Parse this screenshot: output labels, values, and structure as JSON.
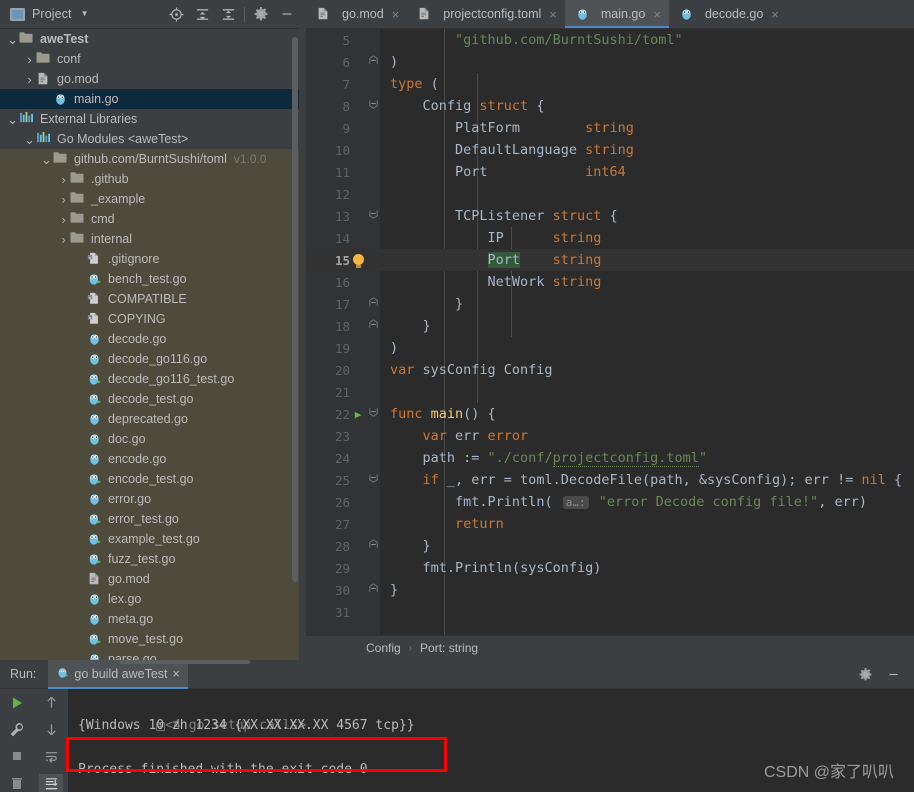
{
  "project_panel": {
    "title": "Project",
    "title_icon": "project-panel-icon",
    "chevron_icon": "chevron-down-icon",
    "tools": [
      {
        "name": "locate-file-icon",
        "label": "Select Opened File"
      },
      {
        "name": "expand-all-icon",
        "label": "Expand All"
      },
      {
        "name": "collapse-all-icon",
        "label": "Collapse All"
      },
      {
        "name": "gear-icon",
        "label": "Settings"
      },
      {
        "name": "minimize-icon",
        "label": "Hide"
      }
    ],
    "tree": [
      {
        "label": "aweTest",
        "indent": 0,
        "arrow": "down",
        "icon": "folder-module-icon",
        "bold": true,
        "selected": false,
        "library": false,
        "version": ""
      },
      {
        "label": "conf",
        "indent": 1,
        "arrow": "right",
        "icon": "folder-icon",
        "bold": false,
        "selected": false,
        "library": false,
        "version": ""
      },
      {
        "label": "go.mod",
        "indent": 1,
        "arrow": "right",
        "icon": "gomod-icon",
        "bold": false,
        "selected": false,
        "library": false,
        "version": ""
      },
      {
        "label": "main.go",
        "indent": 2,
        "arrow": "none",
        "icon": "go-file-icon",
        "bold": false,
        "selected": true,
        "library": false,
        "version": ""
      },
      {
        "label": "External Libraries",
        "indent": 0,
        "arrow": "down",
        "icon": "libraries-icon",
        "bold": false,
        "selected": false,
        "library": false,
        "version": ""
      },
      {
        "label": "Go Modules <aweTest>",
        "indent": 1,
        "arrow": "down",
        "icon": "libraries-icon",
        "bold": false,
        "selected": false,
        "library": false,
        "version": ""
      },
      {
        "label": "github.com/BurntSushi/toml",
        "indent": 2,
        "arrow": "down",
        "icon": "folder-icon",
        "bold": false,
        "selected": false,
        "library": true,
        "version": "v1.0.0"
      },
      {
        "label": ".github",
        "indent": 3,
        "arrow": "right",
        "icon": "folder-icon",
        "bold": false,
        "selected": false,
        "library": true,
        "version": ""
      },
      {
        "label": "_example",
        "indent": 3,
        "arrow": "right",
        "icon": "folder-icon",
        "bold": false,
        "selected": false,
        "library": true,
        "version": ""
      },
      {
        "label": "cmd",
        "indent": 3,
        "arrow": "right",
        "icon": "folder-icon",
        "bold": false,
        "selected": false,
        "library": true,
        "version": ""
      },
      {
        "label": "internal",
        "indent": 3,
        "arrow": "right",
        "icon": "folder-icon",
        "bold": false,
        "selected": false,
        "library": true,
        "version": ""
      },
      {
        "label": ".gitignore",
        "indent": 4,
        "arrow": "none",
        "icon": "text-file-icon",
        "bold": false,
        "selected": false,
        "library": true,
        "version": ""
      },
      {
        "label": "bench_test.go",
        "indent": 4,
        "arrow": "none",
        "icon": "go-test-file-icon",
        "bold": false,
        "selected": false,
        "library": true,
        "version": ""
      },
      {
        "label": "COMPATIBLE",
        "indent": 4,
        "arrow": "none",
        "icon": "text-file-icon",
        "bold": false,
        "selected": false,
        "library": true,
        "version": ""
      },
      {
        "label": "COPYING",
        "indent": 4,
        "arrow": "none",
        "icon": "text-file-icon",
        "bold": false,
        "selected": false,
        "library": true,
        "version": ""
      },
      {
        "label": "decode.go",
        "indent": 4,
        "arrow": "none",
        "icon": "go-file-icon",
        "bold": false,
        "selected": false,
        "library": true,
        "version": ""
      },
      {
        "label": "decode_go116.go",
        "indent": 4,
        "arrow": "none",
        "icon": "go-file-icon",
        "bold": false,
        "selected": false,
        "library": true,
        "version": ""
      },
      {
        "label": "decode_go116_test.go",
        "indent": 4,
        "arrow": "none",
        "icon": "go-test-file-icon",
        "bold": false,
        "selected": false,
        "library": true,
        "version": ""
      },
      {
        "label": "decode_test.go",
        "indent": 4,
        "arrow": "none",
        "icon": "go-test-file-icon",
        "bold": false,
        "selected": false,
        "library": true,
        "version": ""
      },
      {
        "label": "deprecated.go",
        "indent": 4,
        "arrow": "none",
        "icon": "go-file-icon",
        "bold": false,
        "selected": false,
        "library": true,
        "version": ""
      },
      {
        "label": "doc.go",
        "indent": 4,
        "arrow": "none",
        "icon": "go-file-icon",
        "bold": false,
        "selected": false,
        "library": true,
        "version": ""
      },
      {
        "label": "encode.go",
        "indent": 4,
        "arrow": "none",
        "icon": "go-file-icon",
        "bold": false,
        "selected": false,
        "library": true,
        "version": ""
      },
      {
        "label": "encode_test.go",
        "indent": 4,
        "arrow": "none",
        "icon": "go-test-file-icon",
        "bold": false,
        "selected": false,
        "library": true,
        "version": ""
      },
      {
        "label": "error.go",
        "indent": 4,
        "arrow": "none",
        "icon": "go-file-icon",
        "bold": false,
        "selected": false,
        "library": true,
        "version": ""
      },
      {
        "label": "error_test.go",
        "indent": 4,
        "arrow": "none",
        "icon": "go-test-file-icon",
        "bold": false,
        "selected": false,
        "library": true,
        "version": ""
      },
      {
        "label": "example_test.go",
        "indent": 4,
        "arrow": "none",
        "icon": "go-test-file-icon",
        "bold": false,
        "selected": false,
        "library": true,
        "version": ""
      },
      {
        "label": "fuzz_test.go",
        "indent": 4,
        "arrow": "none",
        "icon": "go-test-file-icon",
        "bold": false,
        "selected": false,
        "library": true,
        "version": ""
      },
      {
        "label": "go.mod",
        "indent": 4,
        "arrow": "none",
        "icon": "gomod-icon",
        "bold": false,
        "selected": false,
        "library": true,
        "version": ""
      },
      {
        "label": "lex.go",
        "indent": 4,
        "arrow": "none",
        "icon": "go-file-icon",
        "bold": false,
        "selected": false,
        "library": true,
        "version": ""
      },
      {
        "label": "meta.go",
        "indent": 4,
        "arrow": "none",
        "icon": "go-file-icon",
        "bold": false,
        "selected": false,
        "library": true,
        "version": ""
      },
      {
        "label": "move_test.go",
        "indent": 4,
        "arrow": "none",
        "icon": "go-test-file-icon",
        "bold": false,
        "selected": false,
        "library": true,
        "version": ""
      },
      {
        "label": "parse.go",
        "indent": 4,
        "arrow": "none",
        "icon": "go-file-icon",
        "bold": false,
        "selected": false,
        "library": true,
        "version": ""
      }
    ]
  },
  "tabs": [
    {
      "label": "go.mod",
      "icon": "gomod-icon",
      "active": false,
      "close": "×"
    },
    {
      "label": "projectconfig.toml",
      "icon": "toml-file-icon",
      "active": false,
      "close": "×"
    },
    {
      "label": "main.go",
      "icon": "go-file-icon",
      "active": true,
      "close": "×"
    },
    {
      "label": "decode.go",
      "icon": "go-file-icon",
      "active": false,
      "close": "×"
    }
  ],
  "editor": {
    "lines": [
      {
        "num": "5",
        "fold": "",
        "mark": "",
        "indent": 2,
        "highlight": false,
        "tokens": [
          {
            "t": "\"github.com/BurntSushi/toml\"",
            "c": "s"
          }
        ]
      },
      {
        "num": "6",
        "fold": "up",
        "mark": "",
        "indent": 0,
        "highlight": false,
        "tokens": [
          {
            "t": ")",
            "c": "id"
          }
        ]
      },
      {
        "num": "7",
        "fold": "",
        "mark": "",
        "indent": 0,
        "highlight": false,
        "tokens": [
          {
            "t": "type",
            "c": "k"
          },
          {
            "t": " (",
            "c": "id"
          }
        ]
      },
      {
        "num": "8",
        "fold": "dn",
        "mark": "",
        "indent": 1,
        "highlight": false,
        "tokens": [
          {
            "t": "Config ",
            "c": "id"
          },
          {
            "t": "struct",
            "c": "k"
          },
          {
            "t": " {",
            "c": "id"
          }
        ]
      },
      {
        "num": "9",
        "fold": "",
        "mark": "",
        "indent": 2,
        "highlight": false,
        "tokens": [
          {
            "t": "PlatForm        ",
            "c": "id"
          },
          {
            "t": "string",
            "c": "k"
          }
        ]
      },
      {
        "num": "10",
        "fold": "",
        "mark": "",
        "indent": 2,
        "highlight": false,
        "tokens": [
          {
            "t": "DefaultLanguage ",
            "c": "id"
          },
          {
            "t": "string",
            "c": "k"
          }
        ]
      },
      {
        "num": "11",
        "fold": "",
        "mark": "",
        "indent": 2,
        "highlight": false,
        "tokens": [
          {
            "t": "Port            ",
            "c": "id"
          },
          {
            "t": "int64",
            "c": "k"
          }
        ]
      },
      {
        "num": "12",
        "fold": "",
        "mark": "",
        "indent": 0,
        "highlight": false,
        "tokens": []
      },
      {
        "num": "13",
        "fold": "dn",
        "mark": "",
        "indent": 2,
        "highlight": false,
        "tokens": [
          {
            "t": "TCPListener ",
            "c": "id"
          },
          {
            "t": "struct",
            "c": "k"
          },
          {
            "t": " {",
            "c": "id"
          }
        ]
      },
      {
        "num": "14",
        "fold": "",
        "mark": "",
        "indent": 3,
        "highlight": false,
        "tokens": [
          {
            "t": "IP      ",
            "c": "id"
          },
          {
            "t": "string",
            "c": "k"
          }
        ]
      },
      {
        "num": "15",
        "fold": "",
        "mark": "bulb",
        "indent": 3,
        "highlight": true,
        "tokens": [
          {
            "t": "Port",
            "c": "portsel"
          },
          {
            "t": "    ",
            "c": "id"
          },
          {
            "t": "string",
            "c": "k"
          }
        ]
      },
      {
        "num": "16",
        "fold": "",
        "mark": "",
        "indent": 3,
        "highlight": false,
        "tokens": [
          {
            "t": "NetWork ",
            "c": "id"
          },
          {
            "t": "string",
            "c": "k"
          }
        ]
      },
      {
        "num": "17",
        "fold": "up",
        "mark": "",
        "indent": 2,
        "highlight": false,
        "tokens": [
          {
            "t": "}",
            "c": "id"
          }
        ]
      },
      {
        "num": "18",
        "fold": "up",
        "mark": "",
        "indent": 1,
        "highlight": false,
        "tokens": [
          {
            "t": "}",
            "c": "id"
          }
        ]
      },
      {
        "num": "19",
        "fold": "",
        "mark": "",
        "indent": 0,
        "highlight": false,
        "tokens": [
          {
            "t": ")",
            "c": "id"
          }
        ]
      },
      {
        "num": "20",
        "fold": "",
        "mark": "",
        "indent": 0,
        "highlight": false,
        "tokens": [
          {
            "t": "var",
            "c": "k"
          },
          {
            "t": " sysConfig ",
            "c": "id"
          },
          {
            "t": "Config",
            "c": "id"
          }
        ]
      },
      {
        "num": "21",
        "fold": "",
        "mark": "",
        "indent": 0,
        "highlight": false,
        "tokens": []
      },
      {
        "num": "22",
        "fold": "dn",
        "mark": "run",
        "indent": 0,
        "highlight": false,
        "tokens": [
          {
            "t": "func",
            "c": "k"
          },
          {
            "t": " ",
            "c": "id"
          },
          {
            "t": "main",
            "c": "fn"
          },
          {
            "t": "() {",
            "c": "id"
          }
        ]
      },
      {
        "num": "23",
        "fold": "",
        "mark": "",
        "indent": 1,
        "highlight": false,
        "tokens": [
          {
            "t": "var",
            "c": "k"
          },
          {
            "t": " err ",
            "c": "id"
          },
          {
            "t": "error",
            "c": "k"
          }
        ]
      },
      {
        "num": "24",
        "fold": "",
        "mark": "",
        "indent": 1,
        "highlight": false,
        "tokens": [
          {
            "t": "path := ",
            "c": "id"
          },
          {
            "t": "\"./conf/",
            "c": "s"
          },
          {
            "t": "projectconfig.toml",
            "c": "s uline"
          },
          {
            "t": "\"",
            "c": "s"
          }
        ]
      },
      {
        "num": "25",
        "fold": "dn",
        "mark": "",
        "indent": 1,
        "highlight": false,
        "tokens": [
          {
            "t": "if",
            "c": "k"
          },
          {
            "t": " _, err = toml.",
            "c": "id"
          },
          {
            "t": "DecodeFile",
            "c": "id"
          },
          {
            "t": "(path, &sysConfig); err ",
            "c": "id"
          },
          {
            "t": "!=",
            "c": "id"
          },
          {
            "t": " ",
            "c": "id"
          },
          {
            "t": "nil",
            "c": "k"
          },
          {
            "t": " {",
            "c": "id"
          }
        ]
      },
      {
        "num": "26",
        "fold": "",
        "mark": "",
        "indent": 2,
        "highlight": false,
        "tokens": [
          {
            "t": "fmt.",
            "c": "id"
          },
          {
            "t": "Println",
            "c": "id"
          },
          {
            "t": "( ",
            "c": "id"
          },
          {
            "t": "a…:",
            "c": "chip"
          },
          {
            "t": " ",
            "c": "id"
          },
          {
            "t": "\"error Decode config file!\"",
            "c": "s"
          },
          {
            "t": ", err)",
            "c": "id"
          }
        ]
      },
      {
        "num": "27",
        "fold": "",
        "mark": "",
        "indent": 2,
        "highlight": false,
        "tokens": [
          {
            "t": "return",
            "c": "k"
          }
        ]
      },
      {
        "num": "28",
        "fold": "up",
        "mark": "",
        "indent": 1,
        "highlight": false,
        "tokens": [
          {
            "t": "}",
            "c": "id"
          }
        ]
      },
      {
        "num": "29",
        "fold": "",
        "mark": "",
        "indent": 1,
        "highlight": false,
        "tokens": [
          {
            "t": "fmt.",
            "c": "id"
          },
          {
            "t": "Println",
            "c": "id"
          },
          {
            "t": "(sysConfig)",
            "c": "id"
          }
        ]
      },
      {
        "num": "30",
        "fold": "up",
        "mark": "",
        "indent": 0,
        "highlight": false,
        "tokens": [
          {
            "t": "}",
            "c": "id"
          }
        ]
      },
      {
        "num": "31",
        "fold": "",
        "mark": "",
        "indent": 0,
        "highlight": false,
        "tokens": []
      }
    ]
  },
  "breadcrumb": {
    "items": [
      "Config",
      "Port: string"
    ],
    "separator": "›"
  },
  "run_panel": {
    "label": "Run:",
    "tab": {
      "label": "go build aweTest",
      "icon": "go-file-icon",
      "close": "×"
    },
    "right_tools": [
      {
        "name": "gear-icon",
        "label": "Settings"
      },
      {
        "name": "minimize-icon",
        "label": "Hide"
      }
    ],
    "left_tools": [
      {
        "name": "rerun-icon",
        "label": "Rerun"
      },
      {
        "name": "wrench-icon",
        "label": "Edit Configuration"
      },
      {
        "name": "stop-icon",
        "label": "Stop"
      },
      {
        "name": "trash-icon",
        "label": "Clear"
      }
    ],
    "nav_tools": [
      {
        "name": "arrow-up-icon",
        "label": "Up the Stack Trace"
      },
      {
        "name": "arrow-down-icon",
        "label": "Down the Stack Trace"
      },
      {
        "name": "soft-wrap-icon",
        "label": "Soft-Wrap"
      },
      {
        "name": "scroll-end-icon",
        "label": "Scroll to End",
        "active": true
      }
    ],
    "console": {
      "setup_calls": "<4 go setup calls>",
      "setup_expand_icon": "expand-plus-icon",
      "output_line": "{Windows 10 zh 1234 {XX.XX.XX.XX 4567 tcp}}",
      "blank_line": "",
      "finished_line": "Process finished with the exit code 0"
    },
    "highlight_color": "#ff0000"
  },
  "watermark": "CSDN @家了叭叭",
  "colors": {
    "panel_bg": "#3c3f41",
    "editor_bg": "#2b2b2b",
    "gutter_bg": "#313335",
    "library_bg": "#4e4b3c",
    "selection_bg": "#0d293e",
    "accent": "#4a88c7",
    "keyword": "#cc7832",
    "string": "#6a8759",
    "function": "#ffc66d",
    "text": "#a9b7c6"
  }
}
